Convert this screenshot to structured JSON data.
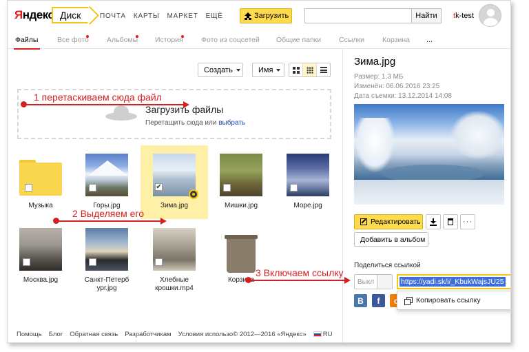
{
  "header": {
    "logo_first": "Я",
    "logo_rest": "ндекс",
    "service_tab": "Диск",
    "nav": [
      "ПОЧТА",
      "КАРТЫ",
      "МАРКЕТ",
      "ЕЩЁ"
    ],
    "upload_label": "Загрузить",
    "search_placeholder": "",
    "search_button": "Найти",
    "user_first": "t",
    "user_rest": "k-test"
  },
  "subnav": [
    {
      "label": "Файлы",
      "active": true,
      "dot": false
    },
    {
      "label": "Все фото",
      "active": false,
      "dot": true
    },
    {
      "label": "Альбомы",
      "active": false,
      "dot": true
    },
    {
      "label": "История",
      "active": false,
      "dot": true
    },
    {
      "label": "Фото из соцсетей",
      "active": false,
      "dot": false
    },
    {
      "label": "Общие папки",
      "active": false,
      "dot": false
    },
    {
      "label": "Ссылки",
      "active": false,
      "dot": false
    },
    {
      "label": "Корзина",
      "active": false,
      "dot": false
    },
    {
      "label": "...",
      "active": false,
      "dot": false
    }
  ],
  "toolbar": {
    "create_label": "Создать",
    "sort_label": "Имя",
    "view_mode": "grid-small"
  },
  "dropzone": {
    "title": "Загрузить файлы",
    "hint": "Перетащить сюда или",
    "hint_link": "выбрать"
  },
  "files": [
    {
      "name": "Музыка",
      "kind": "folder",
      "checked": false
    },
    {
      "name": "Горы.jpg",
      "kind": "image",
      "checked": false
    },
    {
      "name": "Зима.jpg",
      "kind": "image",
      "checked": true
    },
    {
      "name": "Мишки.jpg",
      "kind": "image",
      "checked": false
    },
    {
      "name": "Море.jpg",
      "kind": "image",
      "checked": false
    },
    {
      "name": "Москва.jpg",
      "kind": "image",
      "checked": false
    },
    {
      "name": "Санкт-Петербург.jpg",
      "name_lines": [
        "Санкт-Петерб",
        "ург.jpg"
      ],
      "kind": "image",
      "checked": false
    },
    {
      "name": "Хлебные крошки.mp4",
      "name_lines": [
        "Хлебные",
        "крошки.mp4"
      ],
      "kind": "video",
      "checked": false
    },
    {
      "name": "Корзина",
      "kind": "trash",
      "checked": false
    }
  ],
  "footer": {
    "links": [
      "Помощь",
      "Блог",
      "Обратная связь",
      "Разработчикам",
      "Условия использо"
    ],
    "copyright": "© 2012—2016 «Яндекс»",
    "lang": "RU"
  },
  "panel": {
    "title": "Зима.jpg",
    "size": "Размер: 1,3 МБ",
    "modified": "Изменён: 06.06.2016 23:25",
    "shot_date": "Дата съемки: 13.12.2014 14:08",
    "edit_label": "Редактировать",
    "more_label": "···",
    "album_label": "Добавить в альбом",
    "share_label": "Поделиться ссылкой",
    "toggle_label": "Выкл",
    "link_value": "https://yadi.sk/i/_KbukWajsJU25",
    "social": [
      {
        "icon": "vk-icon",
        "glyph": "В",
        "color": "#4a76a8"
      },
      {
        "icon": "facebook-icon",
        "glyph": "f",
        "color": "#3b5998"
      },
      {
        "icon": "odnoklassniki-icon",
        "glyph": "о",
        "color": "#ee8208"
      }
    ],
    "copy_label": "Копировать ссылку"
  },
  "annotations": {
    "step1": "1 перетаскиваем сюда файл",
    "step2": "2 Выделяем его",
    "step3": "3 Включаем ссылку"
  },
  "colors": {
    "accent_yellow": "#ffdb4d",
    "brand_red": "#e01b1b",
    "annotation_red": "#d42020",
    "link_blue": "#1a4bb0"
  }
}
